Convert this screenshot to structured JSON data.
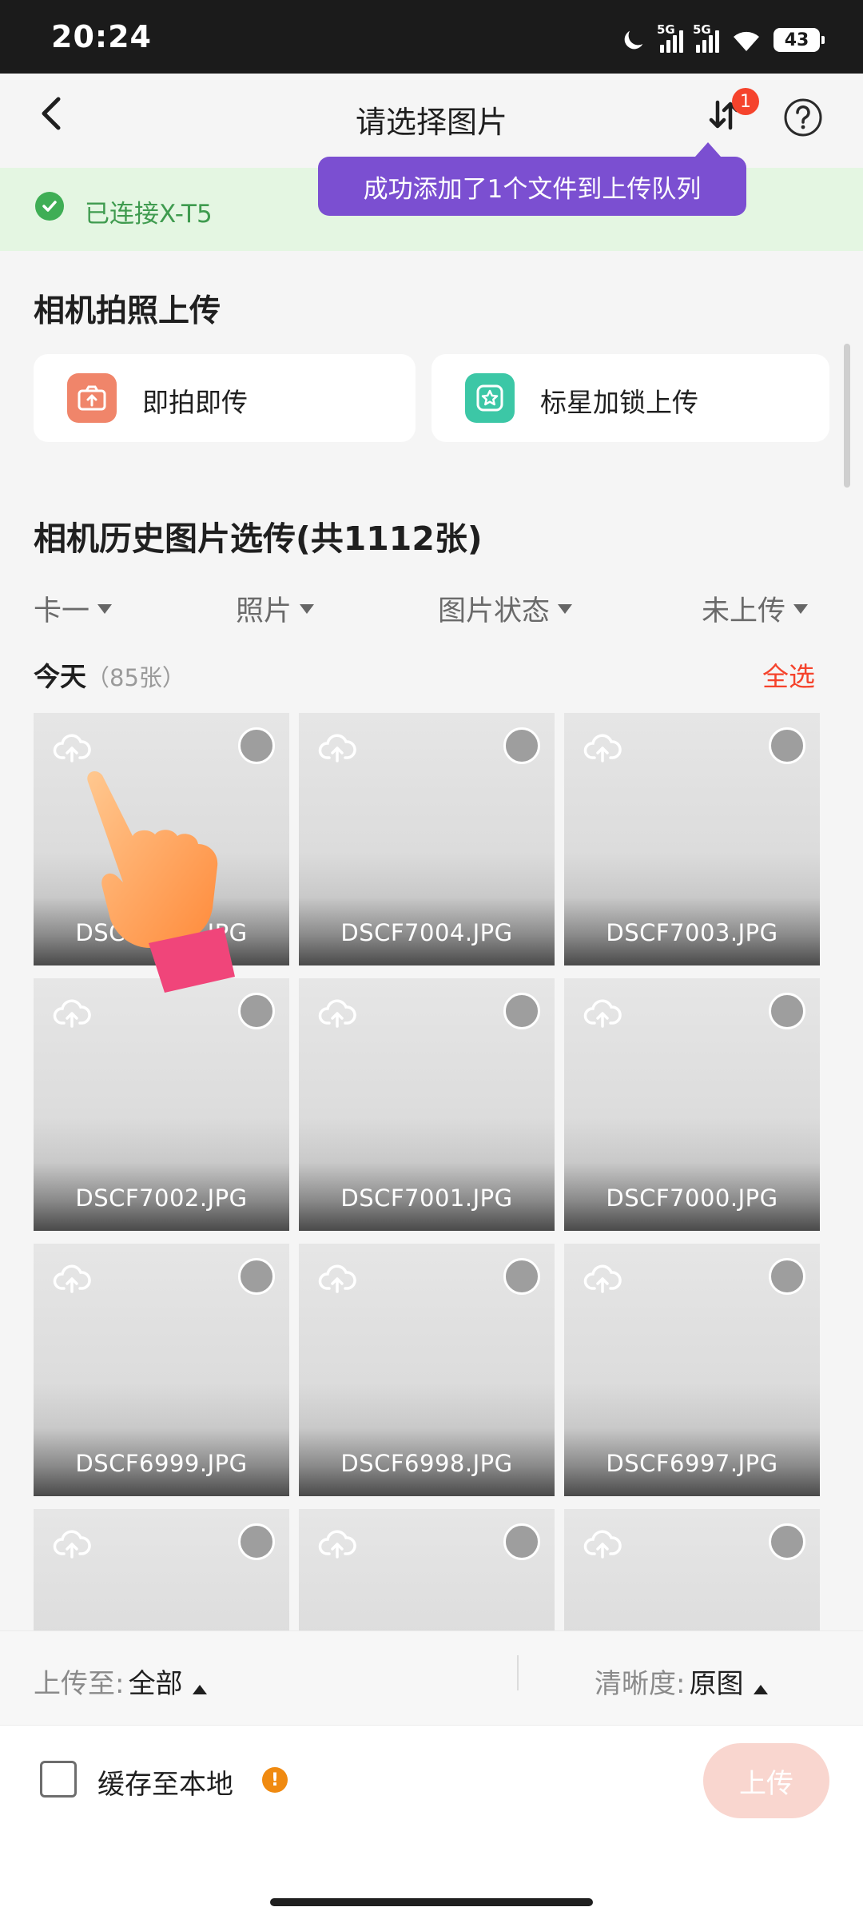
{
  "status_bar": {
    "time": "20:24",
    "net1": "5G",
    "net2": "5G",
    "battery": "43"
  },
  "header": {
    "title": "请选择图片",
    "badge": "1"
  },
  "connection": {
    "text": "已连接X-T5"
  },
  "toast": {
    "text": "成功添加了1个文件到上传队列"
  },
  "camera_upload": {
    "title": "相机拍照上传",
    "options": [
      {
        "label": "即拍即传",
        "icon": "camera-upload-icon",
        "color": "#f0856a"
      },
      {
        "label": "标星加锁上传",
        "icon": "star-lock-icon",
        "color": "#3cc7a6"
      }
    ]
  },
  "history": {
    "title": "相机历史图片选传(共1112张)",
    "filters": [
      "卡一",
      "照片",
      "图片状态",
      "未上传"
    ],
    "group_label": "今天",
    "group_count": "（85张）",
    "select_all": "全选",
    "photos": [
      "DSCF7005.JPG",
      "DSCF7004.JPG",
      "DSCF7003.JPG",
      "DSCF7002.JPG",
      "DSCF7001.JPG",
      "DSCF7000.JPG",
      "DSCF6999.JPG",
      "DSCF6998.JPG",
      "DSCF6997.JPG",
      "",
      "",
      ""
    ]
  },
  "bottom": {
    "upload_to_label": "上传至:",
    "upload_to_value": "全部",
    "clarity_label": "清晰度:",
    "clarity_value": "原图",
    "cache_label": "缓存至本地",
    "upload_button": "上传"
  },
  "colors": {
    "accent": "#f5432c",
    "toast": "#7b4fd1",
    "connected": "#3fae55"
  }
}
